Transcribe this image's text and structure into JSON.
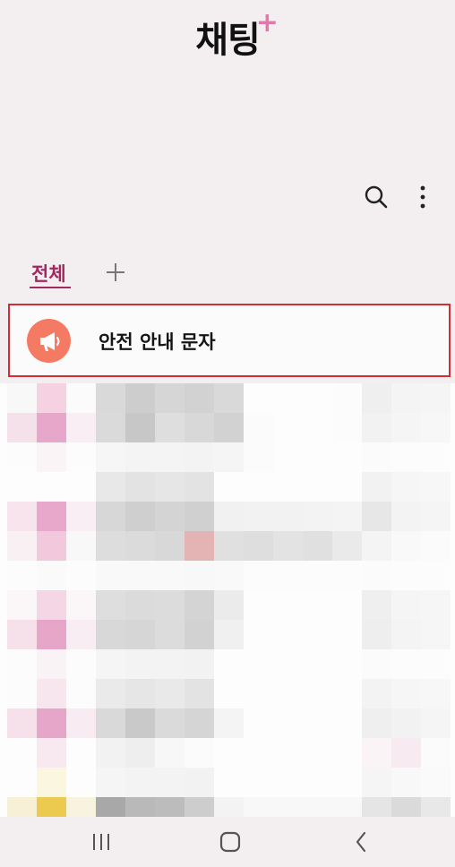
{
  "header": {
    "app_title": "채팅",
    "title_plus": "+"
  },
  "toolbar": {
    "search_icon": "search-icon",
    "more_icon": "more-vertical-icon"
  },
  "tabs": [
    {
      "label": "전체",
      "active": true
    },
    {
      "label": "+",
      "icon": "add-tab-icon"
    }
  ],
  "notice": {
    "title": "안전 안내 문자",
    "icon": "megaphone-icon",
    "avatar_color": "#f47a63",
    "highlight_color": "#d32e36"
  },
  "colors": {
    "accent": "#a3285f",
    "title_plus": "#e478ad",
    "background": "#f3eff0"
  },
  "navbar": {
    "recent_icon": "recent-apps-icon",
    "home_icon": "home-icon",
    "back_icon": "back-icon"
  }
}
